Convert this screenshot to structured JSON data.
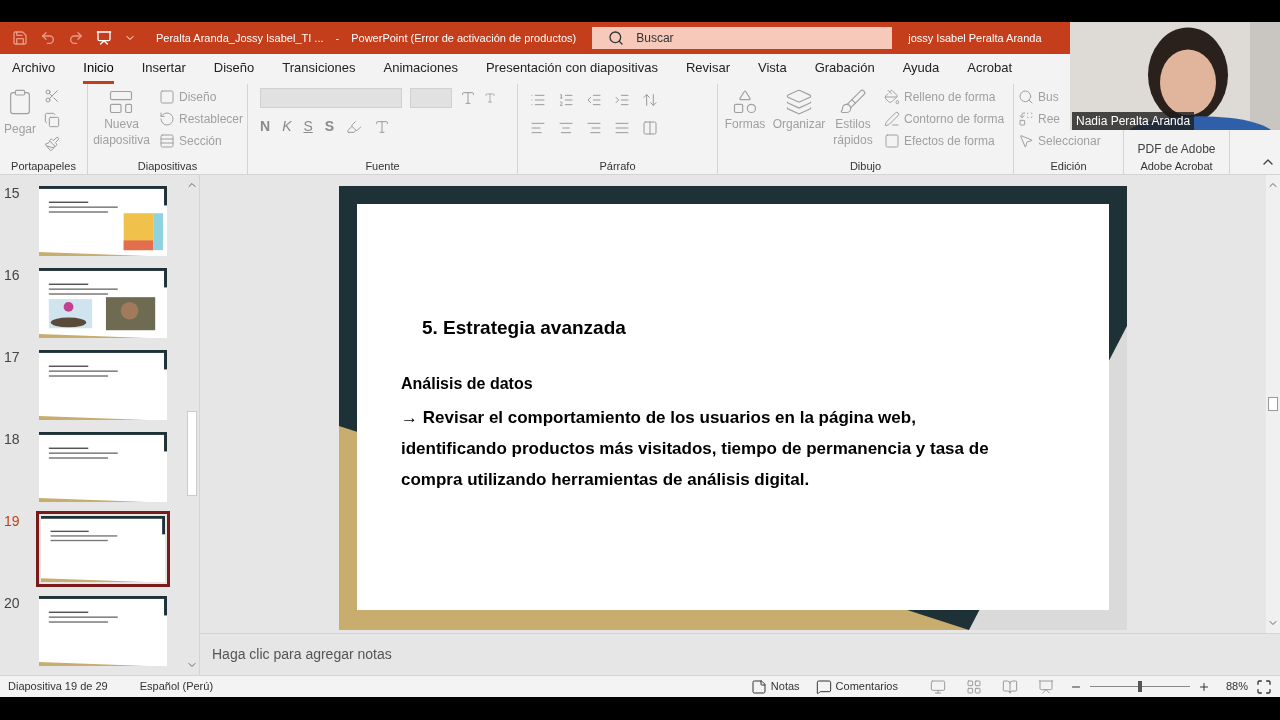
{
  "title_bar": {
    "document_title": "Peralta Aranda_Jossy Isabel_TI ...",
    "separator": "-",
    "app_title": "PowerPoint (Error de activación de productos)",
    "search": {
      "placeholder": "Buscar"
    },
    "user": "jossy Isabel Peralta Aranda"
  },
  "tabs": [
    {
      "label": "Archivo",
      "selected": false
    },
    {
      "label": "Inicio",
      "selected": true
    },
    {
      "label": "Insertar",
      "selected": false
    },
    {
      "label": "Diseño",
      "selected": false
    },
    {
      "label": "Transiciones",
      "selected": false
    },
    {
      "label": "Animaciones",
      "selected": false
    },
    {
      "label": "Presentación con diapositivas",
      "selected": false
    },
    {
      "label": "Revisar",
      "selected": false
    },
    {
      "label": "Vista",
      "selected": false
    },
    {
      "label": "Grabación",
      "selected": false
    },
    {
      "label": "Ayuda",
      "selected": false
    },
    {
      "label": "Acrobat",
      "selected": false
    }
  ],
  "ribbon": {
    "portapapeles": {
      "label": "Portapapeles",
      "paste": "Pegar"
    },
    "diapositivas": {
      "label": "Diapositivas",
      "new_slide": "Nueva diapositiva",
      "items": [
        "Diseño",
        "Restablecer",
        "Sección"
      ]
    },
    "fuente": {
      "label": "Fuente",
      "styles": [
        "N",
        "K",
        "S",
        "S"
      ]
    },
    "parrafo": {
      "label": "Párrafo"
    },
    "dibujo": {
      "label": "Dibujo",
      "big": [
        "Formas",
        "Organizar",
        "Estilos rápidos"
      ],
      "items": [
        "Relleno de forma",
        "Contorno de forma",
        "Efectos de forma"
      ]
    },
    "edicion": {
      "label": "Edición",
      "items": [
        "Bus",
        "Ree",
        "Seleccionar"
      ]
    },
    "acrobat": {
      "label": "Adobe Acrobat",
      "item": "PDF de Adobe"
    }
  },
  "thumbnails": [
    {
      "number": "15",
      "selected": false,
      "kind": "infographic"
    },
    {
      "number": "16",
      "selected": false,
      "kind": "photos"
    },
    {
      "number": "17",
      "selected": false,
      "kind": "text"
    },
    {
      "number": "18",
      "selected": false,
      "kind": "text"
    },
    {
      "number": "19",
      "selected": true,
      "kind": "text"
    },
    {
      "number": "20",
      "selected": false,
      "kind": "text"
    }
  ],
  "slide": {
    "title": "5. Estrategia avanzada",
    "heading": "Análisis de datos",
    "body": "→ Revisar el comportamiento de los usuarios en la página web, identificando productos más visitados, tiempo de permanencia y tasa de compra utilizando herramientas de análisis digital."
  },
  "notes": {
    "placeholder": "Haga clic para agregar notas"
  },
  "status_bar": {
    "slide_info": "Diapositiva 19 de 29",
    "language": "Español (Perú)",
    "notes": "Notas",
    "comments": "Comentarios",
    "zoom": {
      "level": 0.5
    },
    "zoom_value": "88%"
  },
  "webcam": {
    "name": "Nadia Peralta Aranda"
  }
}
